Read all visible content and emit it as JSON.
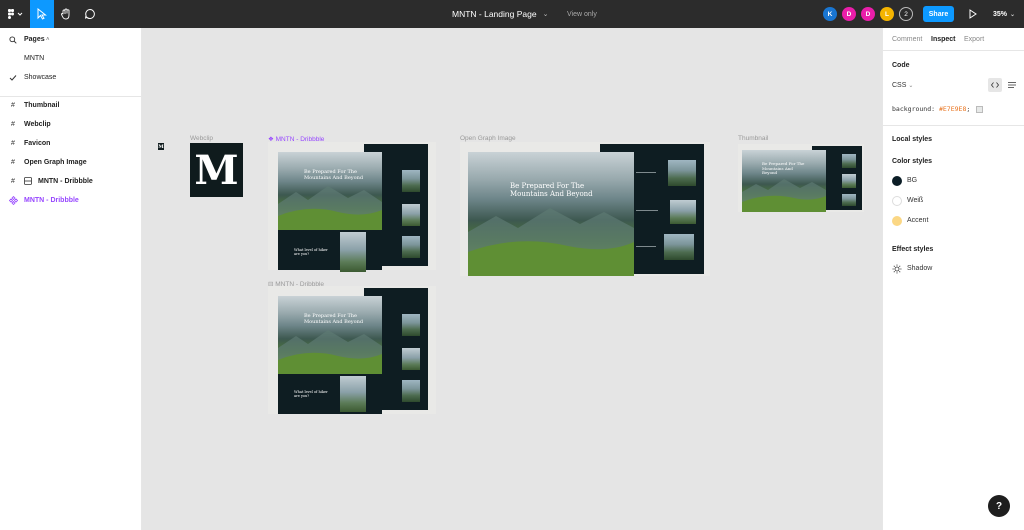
{
  "topbar": {
    "title": "MNTN - Landing Page",
    "view_only": "View only",
    "collaborators": [
      {
        "initial": "K",
        "color": "#1976d2"
      },
      {
        "initial": "D",
        "color": "#e91eaa"
      },
      {
        "initial": "D",
        "color": "#e91eaa"
      },
      {
        "initial": "L",
        "color": "#f4b400"
      }
    ],
    "more_count": "2",
    "share_label": "Share",
    "zoom_label": "35%",
    "accent_color": "#0d99ff"
  },
  "left_panel": {
    "pages_label": "Pages",
    "pages": [
      {
        "name": "MNTN",
        "selected": false
      },
      {
        "name": "Showcase",
        "selected": true
      }
    ],
    "layers": [
      {
        "name": "Thumbnail",
        "icon": "frame-icon"
      },
      {
        "name": "Webclip",
        "icon": "frame-icon"
      },
      {
        "name": "Favicon",
        "icon": "frame-icon"
      },
      {
        "name": "Open Graph Image",
        "icon": "frame-icon"
      },
      {
        "name": "MNTN - Dribbble",
        "icon": "component-set-icon"
      },
      {
        "name": "MNTN - Dribbble",
        "icon": "component-icon",
        "highlight": true
      }
    ]
  },
  "canvas": {
    "labels": {
      "webclip": "Webclip",
      "component_main": "MNTN - Dribbble",
      "open_graph": "Open Graph Image",
      "thumbnail": "Thumbnail",
      "component_instance": "MNTN - Dribbble"
    },
    "favicon_letter": "M",
    "webclip_letter": "M",
    "hero_text": "Be Prepared For The Mountains And Beyond",
    "question_text": "What level of hiker are you?"
  },
  "right_panel": {
    "tabs": [
      "Comment",
      "Inspect",
      "Export"
    ],
    "active_tab": "Inspect",
    "code_heading": "Code",
    "language": "CSS",
    "code_property": "background:",
    "code_value": "#E7E9E8",
    "local_styles_heading": "Local styles",
    "color_styles_heading": "Color styles",
    "color_styles": [
      {
        "name": "BG",
        "color": "#0b1d26"
      },
      {
        "name": "Weiß",
        "color": "#ffffff"
      },
      {
        "name": "Accent",
        "color": "#fbd784"
      }
    ],
    "effect_styles_heading": "Effect styles",
    "effect_styles": [
      {
        "name": "Shadow",
        "icon": "sun-icon"
      }
    ]
  },
  "help_label": "?"
}
